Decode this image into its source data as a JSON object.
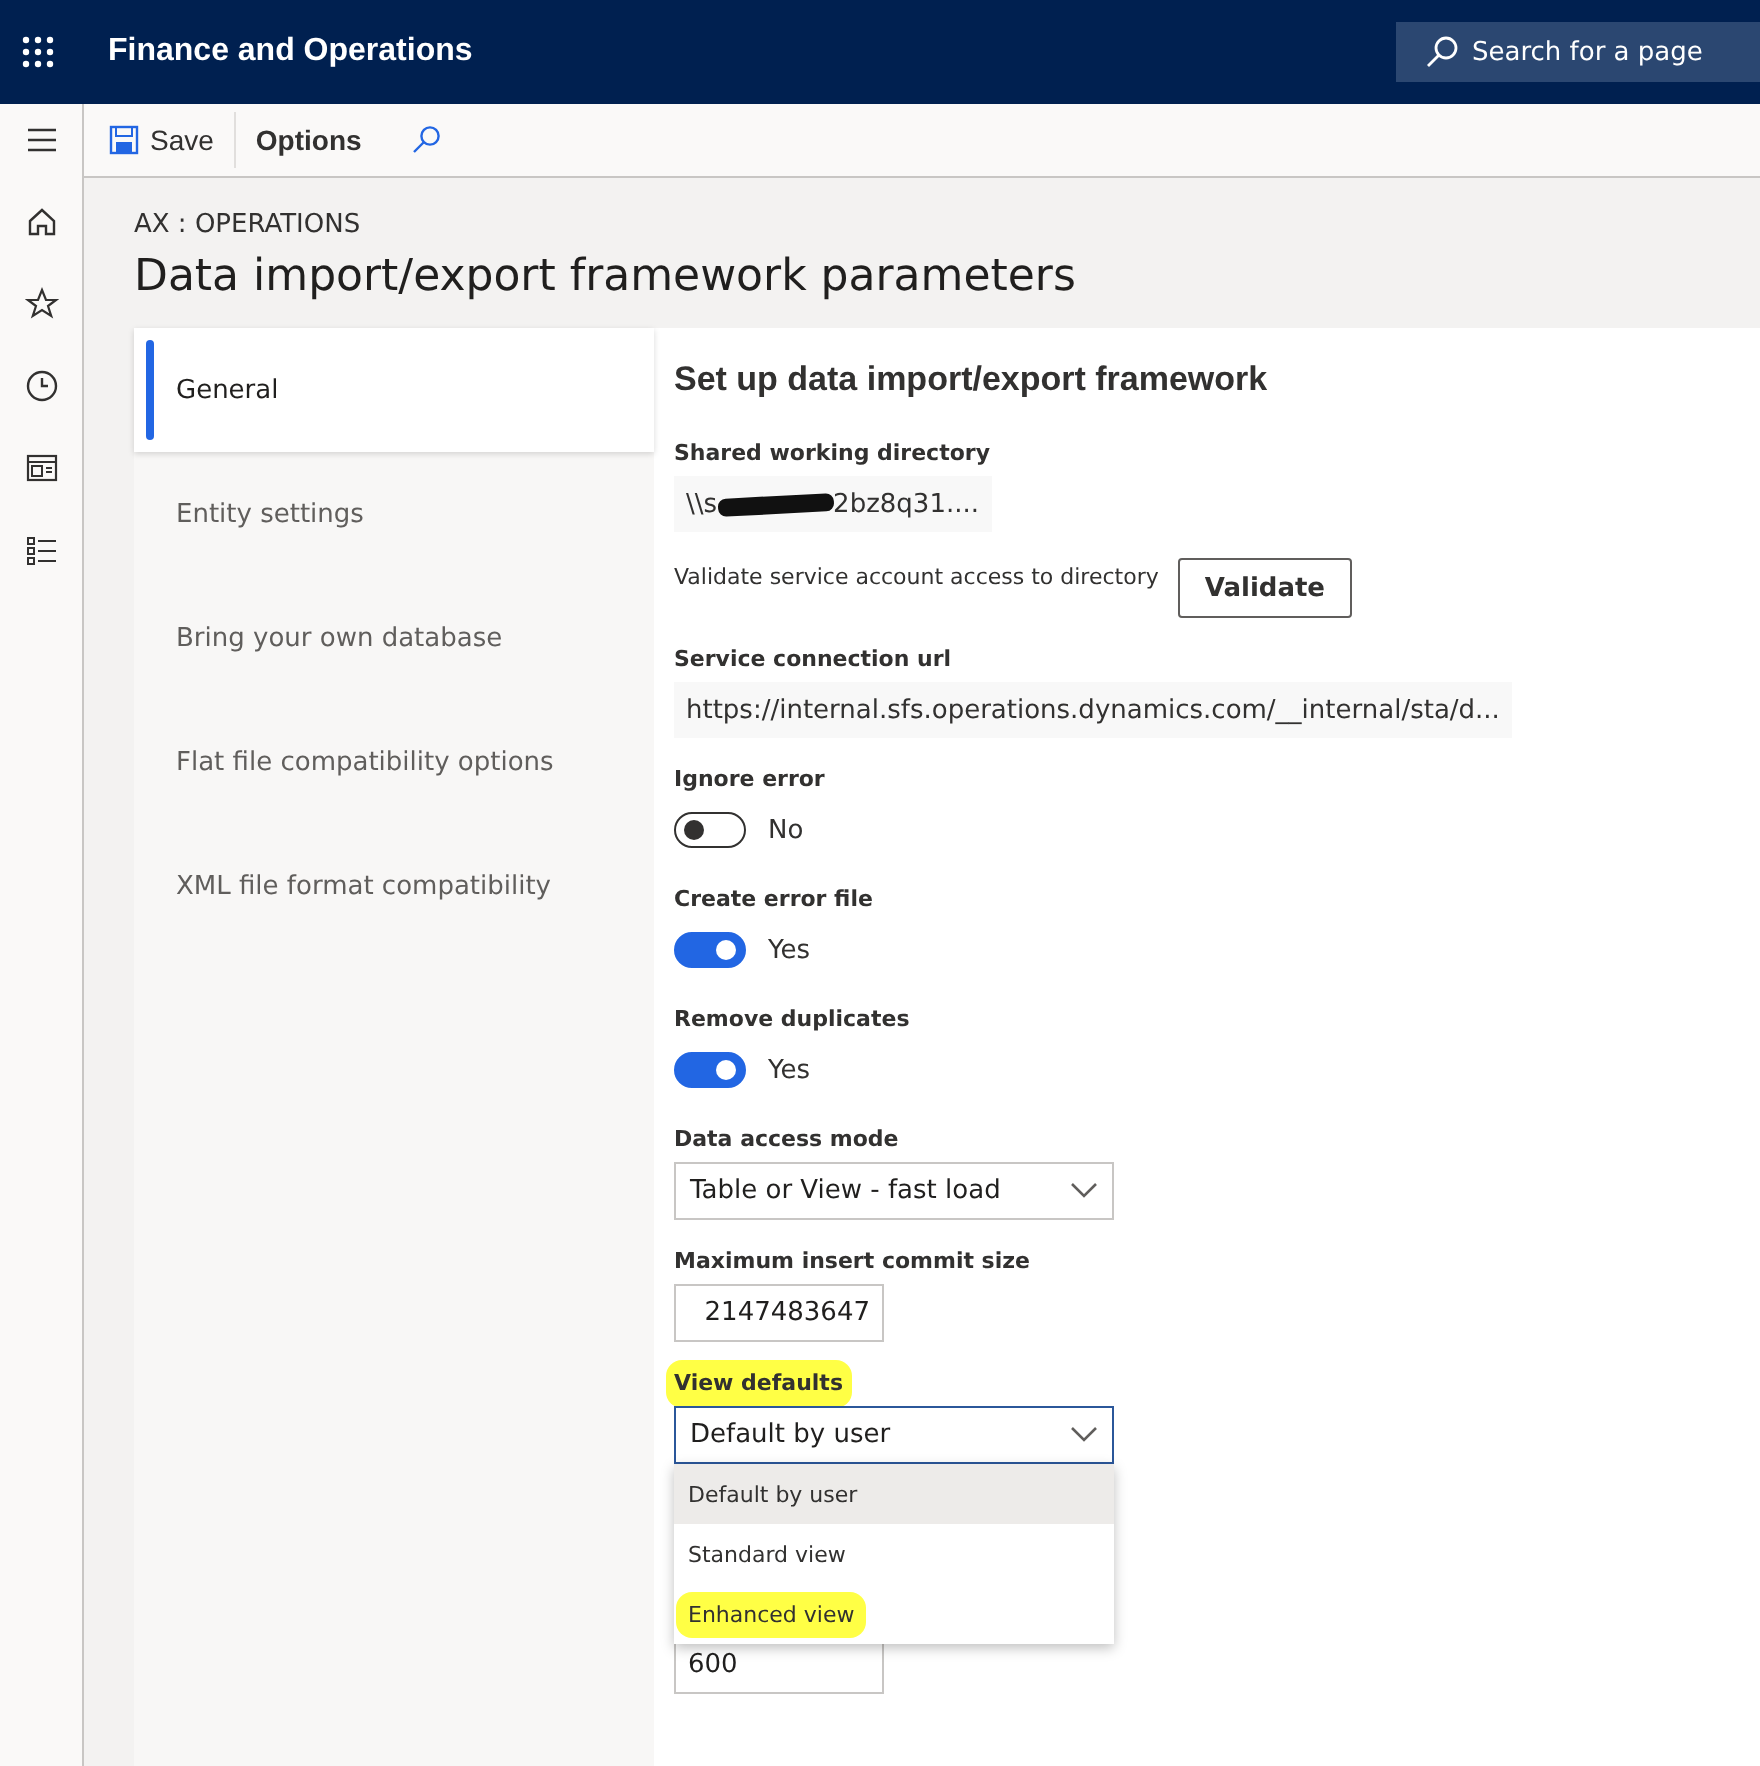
{
  "app_bar": {
    "title": "Finance and Operations",
    "search": {
      "placeholder": "Search for a page"
    }
  },
  "toolbar": {
    "buttons": [
      {
        "label": "Save",
        "kind": "save"
      },
      {
        "label": "Options",
        "kind": "text"
      }
    ]
  },
  "breadcrumb": "AX : OPERATIONS",
  "page_title": "Data import/export framework parameters",
  "tabs": [
    {
      "label": "General",
      "selected": true
    },
    {
      "label": "Entity settings",
      "selected": false
    },
    {
      "label": "Bring your own database",
      "selected": false
    },
    {
      "label": "Flat file compatibility options",
      "selected": false
    },
    {
      "label": "XML file format compatibility",
      "selected": false
    }
  ],
  "section_title": "Set up data import/export framework",
  "fields": [
    {
      "kind": "readonly",
      "label": "Shared working directory",
      "value_start": "\\\\s",
      "value_end": "2bz8q31....",
      "redacted": true
    },
    {
      "kind": "action",
      "text": "Validate service account access to directory",
      "button": "Validate"
    },
    {
      "kind": "readonly",
      "label": "Service connection url",
      "value": "https://internal.sfs.operations.dynamics.com/__internal/sta/d..."
    },
    {
      "kind": "toggle",
      "label": "Ignore error",
      "on": false,
      "value": "No"
    },
    {
      "kind": "toggle",
      "label": "Create error file",
      "on": true,
      "value": "Yes"
    },
    {
      "kind": "toggle",
      "label": "Remove duplicates",
      "on": true,
      "value": "Yes"
    },
    {
      "kind": "dropdown",
      "label": "Data access mode",
      "value": "Table or View - fast load",
      "expanded": false
    },
    {
      "kind": "number",
      "label": "Maximum insert commit size",
      "value": "2147483647"
    },
    {
      "kind": "dropdown",
      "label": "View defaults",
      "value": "Default by user",
      "expanded": true,
      "highlighted": true,
      "options": [
        {
          "label": "Default by user",
          "selected": true,
          "highlighted": false
        },
        {
          "label": "Standard view",
          "selected": false,
          "highlighted": false
        },
        {
          "label": "Enhanced view",
          "selected": false,
          "highlighted": true
        }
      ]
    },
    {
      "kind": "text",
      "value": "600"
    }
  ]
}
